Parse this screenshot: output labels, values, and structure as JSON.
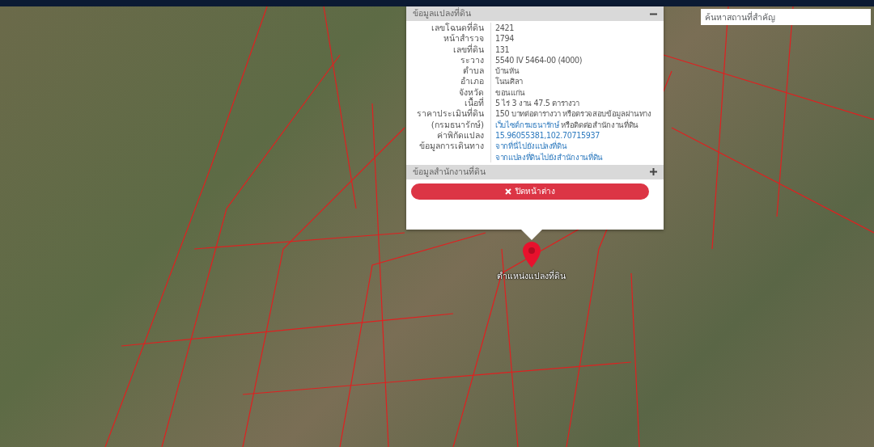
{
  "search": {
    "placeholder": "ค้นหาสถานที่สำคัญ"
  },
  "popup": {
    "sections": [
      {
        "title": "ข้อมูลแปลงที่ดิน",
        "expanded": true,
        "rows": [
          {
            "label": "เลขโฉนดที่ดิน",
            "lines": [
              [
                {
                  "kind": "text",
                  "text": "2421"
                }
              ]
            ]
          },
          {
            "label": "หน้าสำรวจ",
            "lines": [
              [
                {
                  "kind": "text",
                  "text": "1794"
                }
              ]
            ]
          },
          {
            "label": "เลขที่ดิน",
            "lines": [
              [
                {
                  "kind": "text",
                  "text": "131"
                }
              ]
            ]
          },
          {
            "label": "ระวาง",
            "lines": [
              [
                {
                  "kind": "text",
                  "text": "5540 IV 5464-00 (4000)"
                }
              ]
            ]
          },
          {
            "label": "ตำบล",
            "lines": [
              [
                {
                  "kind": "text",
                  "text": "บ้านหัน"
                }
              ]
            ]
          },
          {
            "label": "อำเภอ",
            "lines": [
              [
                {
                  "kind": "text",
                  "text": "โนนศิลา"
                }
              ]
            ]
          },
          {
            "label": "จังหวัด",
            "lines": [
              [
                {
                  "kind": "text",
                  "text": "ขอนแก่น"
                }
              ]
            ]
          },
          {
            "label": "เนื้อที่",
            "lines": [
              [
                {
                  "kind": "text",
                  "text": "5 ไร่ 3 งาน 47.5 ตารางวา"
                }
              ]
            ]
          },
          {
            "label": "ราคาประเมินที่ดิน\n(กรมธนารักษ์)",
            "lines": [
              [
                {
                  "kind": "text",
                  "text": "150 บาทต่อตารางวา หรือตรวจสอบข้อมูลผ่านทาง "
                },
                {
                  "kind": "link",
                  "text": "เว็บไซต์กรมธนารักษ์"
                },
                {
                  "kind": "text",
                  "text": " หรือติดต่อสำนักงานที่ดิน"
                }
              ]
            ]
          },
          {
            "label": "ค่าพิกัดแปลง",
            "lines": [
              [
                {
                  "kind": "link",
                  "text": "15.96055381,102.70715937"
                }
              ]
            ]
          },
          {
            "label": "ข้อมูลการเดินทาง",
            "lines": [
              [
                {
                  "kind": "link",
                  "text": "จากที่นี่ไปยังแปลงที่ดิน"
                }
              ],
              [
                {
                  "kind": "link",
                  "text": "จากแปลงที่ดินไปยังสำนักงานที่ดิน"
                }
              ]
            ]
          }
        ]
      },
      {
        "title": "ข้อมูลสำนักงานที่ดิน",
        "expanded": false
      }
    ],
    "close_button": "ปิดหน้าต่าง"
  },
  "marker": {
    "label": "ตำแหน่งแปลงที่ดิน"
  }
}
